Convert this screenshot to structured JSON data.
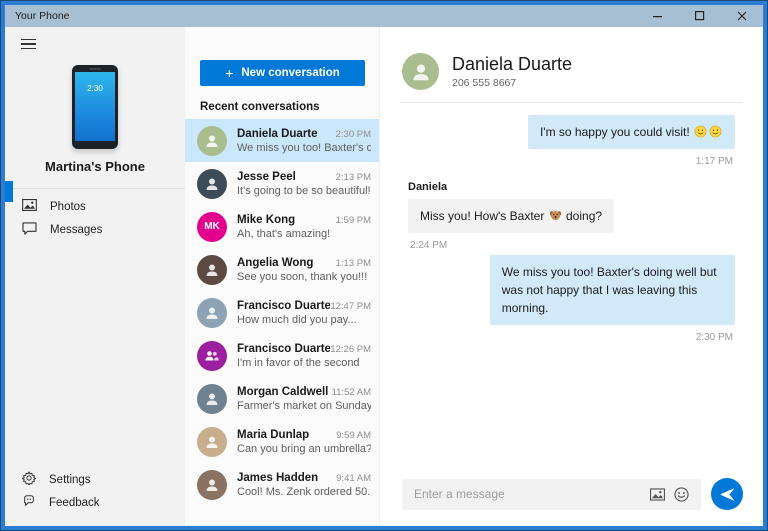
{
  "window": {
    "title": "Your Phone",
    "controls": {
      "minimize": "minimize",
      "maximize": "maximize",
      "close": "close"
    }
  },
  "colors": {
    "accent": "#0078d7",
    "titlebar": "#a7bfd3",
    "window_border": "#2a7dd2",
    "selected_conversation": "#cbe7fb",
    "outgoing_bubble": "#d2e9f9",
    "incoming_bubble": "#f2f2f2"
  },
  "sidebar": {
    "phone_time": "2:30",
    "device_name": "Martina's Phone",
    "nav": [
      {
        "id": "photos",
        "label": "Photos",
        "icon": "photos-icon",
        "selected": false
      },
      {
        "id": "messages",
        "label": "Messages",
        "icon": "messages-icon",
        "selected": true
      }
    ],
    "footer_nav": [
      {
        "id": "settings",
        "label": "Settings",
        "icon": "gear-icon"
      },
      {
        "id": "feedback",
        "label": "Feedback",
        "icon": "feedback-icon"
      }
    ]
  },
  "conversations": {
    "new_button_label": "New conversation",
    "header": "Recent conversations",
    "items": [
      {
        "name": "Daniela Duarte",
        "time": "2:30 PM",
        "preview": "We miss you too! Baxter's doing ...",
        "selected": true,
        "avatar": {
          "type": "photo",
          "color": "#a9bd8f"
        }
      },
      {
        "name": "Jesse Peel",
        "time": "2:13 PM",
        "preview": "It's going to be so beautiful!",
        "selected": false,
        "avatar": {
          "type": "photo",
          "color": "#3d4a58"
        }
      },
      {
        "name": "Mike Kong",
        "time": "1:59 PM",
        "preview": "Ah, that's amazing!",
        "selected": false,
        "avatar": {
          "type": "initials",
          "text": "MK",
          "color": "#e3008c"
        }
      },
      {
        "name": "Angelia Wong",
        "time": "1:13 PM",
        "preview": "See you soon, thank you!!!",
        "selected": false,
        "avatar": {
          "type": "photo",
          "color": "#5d4a42"
        }
      },
      {
        "name": "Francisco Duarte",
        "time": "12:47 PM",
        "preview": "How much did you pay...",
        "selected": false,
        "avatar": {
          "type": "photo",
          "color": "#8da3b5"
        }
      },
      {
        "name": "Francisco Duarte, Dani...",
        "time": "12:26 PM",
        "preview": "I'm in favor of the second",
        "selected": false,
        "avatar": {
          "type": "group",
          "color": "#9b1f9e"
        }
      },
      {
        "name": "Morgan Caldwell",
        "time": "11:52 AM",
        "preview": "Farmer's market on Sunday?",
        "selected": false,
        "avatar": {
          "type": "photo",
          "color": "#6e8292"
        }
      },
      {
        "name": "Maria Dunlap",
        "time": "9:59 AM",
        "preview": "Can you bring an umbrella?",
        "selected": false,
        "avatar": {
          "type": "photo",
          "color": "#c7ad8b"
        }
      },
      {
        "name": "James Hadden",
        "time": "9:41 AM",
        "preview": "Cool! Ms. Zenk ordered 50...",
        "selected": false,
        "avatar": {
          "type": "photo",
          "color": "#8a7262"
        }
      }
    ]
  },
  "chat": {
    "contact": {
      "name": "Daniela Duarte",
      "phone": "206 555 8667",
      "avatar_color": "#a9bd8f"
    },
    "messages": [
      {
        "direction": "outgoing",
        "text": "I'm so happy you could visit! 🙂🙂",
        "time": "1:17 PM"
      },
      {
        "direction": "incoming",
        "sender": "Daniela",
        "text": "Miss you! How's Baxter 🐶 doing?",
        "time": "2:24 PM"
      },
      {
        "direction": "outgoing",
        "text": "We miss you too! Baxter's doing well but was not happy that I was leaving this morning.",
        "time": "2:30 PM"
      }
    ],
    "composer": {
      "placeholder": "Enter a message"
    }
  }
}
